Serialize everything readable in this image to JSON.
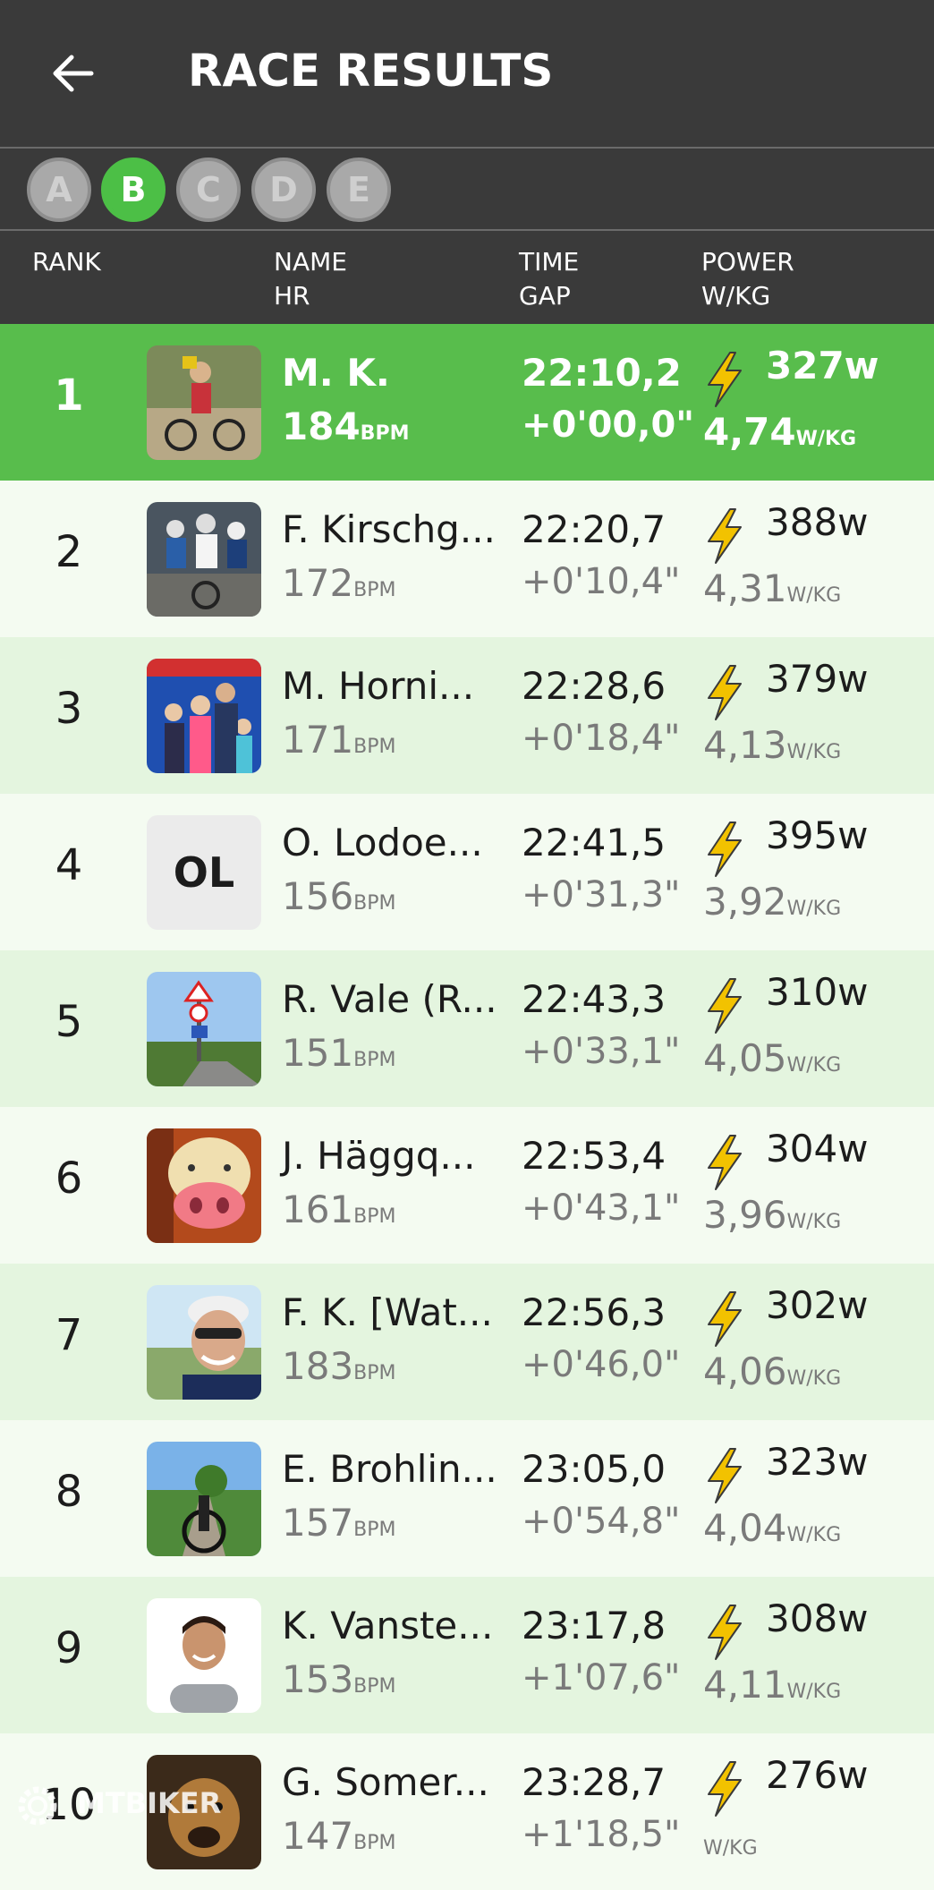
{
  "header": {
    "title": "RACE RESULTS"
  },
  "categories": [
    {
      "label": "A",
      "active": false
    },
    {
      "label": "B",
      "active": true
    },
    {
      "label": "C",
      "active": false
    },
    {
      "label": "D",
      "active": false
    },
    {
      "label": "E",
      "active": false
    }
  ],
  "columns": {
    "rank": "RANK",
    "name": "NAME",
    "hr": "HR",
    "time": "TIME",
    "gap": "GAP",
    "power": "POWER",
    "wkg": "W/KG"
  },
  "units": {
    "bpm": "BPM",
    "w": "w",
    "wkg": "W/KG"
  },
  "results": [
    {
      "rank": "1",
      "name": "M. K.",
      "hr": "184",
      "time": "22:10,2",
      "gap": "+0'00,0\"",
      "power": "327w",
      "wkg": "4,74",
      "avatar": "photo-cyclist-with-bike"
    },
    {
      "rank": "2",
      "name": "F. Kirschg...",
      "hr": "172",
      "time": "22:20,7",
      "gap": "+0'10,4\"",
      "power": "388w",
      "wkg": "4,31",
      "avatar": "photo-group-of-cyclists"
    },
    {
      "rank": "3",
      "name": "M. Horni...",
      "hr": "171",
      "time": "22:28,6",
      "gap": "+0'18,4\"",
      "power": "379w",
      "wkg": "4,13",
      "avatar": "photo-family"
    },
    {
      "rank": "4",
      "name": "O. Lodoe...",
      "hr": "156",
      "time": "22:41,5",
      "gap": "+0'31,3\"",
      "power": "395w",
      "wkg": "3,92",
      "avatar": "initials",
      "initials": "OL"
    },
    {
      "rank": "5",
      "name": "R. Vale (R...",
      "hr": "151",
      "time": "22:43,3",
      "gap": "+0'33,1\"",
      "power": "310w",
      "wkg": "4,05",
      "avatar": "photo-road-sign"
    },
    {
      "rank": "6",
      "name": "J. Häggq...",
      "hr": "161",
      "time": "22:53,4",
      "gap": "+0'43,1\"",
      "power": "304w",
      "wkg": "3,96",
      "avatar": "photo-pig-toy"
    },
    {
      "rank": "7",
      "name": "F. K. [Wat...",
      "hr": "183",
      "time": "22:56,3",
      "gap": "+0'46,0\"",
      "power": "302w",
      "wkg": "4,06",
      "avatar": "photo-selfie-helmet"
    },
    {
      "rank": "8",
      "name": "E. Brohlin...",
      "hr": "157",
      "time": "23:05,0",
      "gap": "+0'54,8\"",
      "power": "323w",
      "wkg": "4,04",
      "avatar": "photo-bike-on-path"
    },
    {
      "rank": "9",
      "name": "K. Vanste...",
      "hr": "153",
      "time": "23:17,8",
      "gap": "+1'07,6\"",
      "power": "308w",
      "wkg": "4,11",
      "avatar": "photo-portrait"
    },
    {
      "rank": "10",
      "name": "G. Somer...",
      "hr": "147",
      "time": "23:28,7",
      "gap": "+1'18,5\"",
      "power": "276w",
      "wkg": "",
      "avatar": "photo-dog"
    }
  ],
  "watermark": "MTBIKER",
  "colors": {
    "header_bg": "#3a3a3a",
    "accent_green": "#58bd4c",
    "row_light": "#f4fbf1",
    "row_alt": "#e4f5df",
    "bolt": "#f2c200"
  }
}
